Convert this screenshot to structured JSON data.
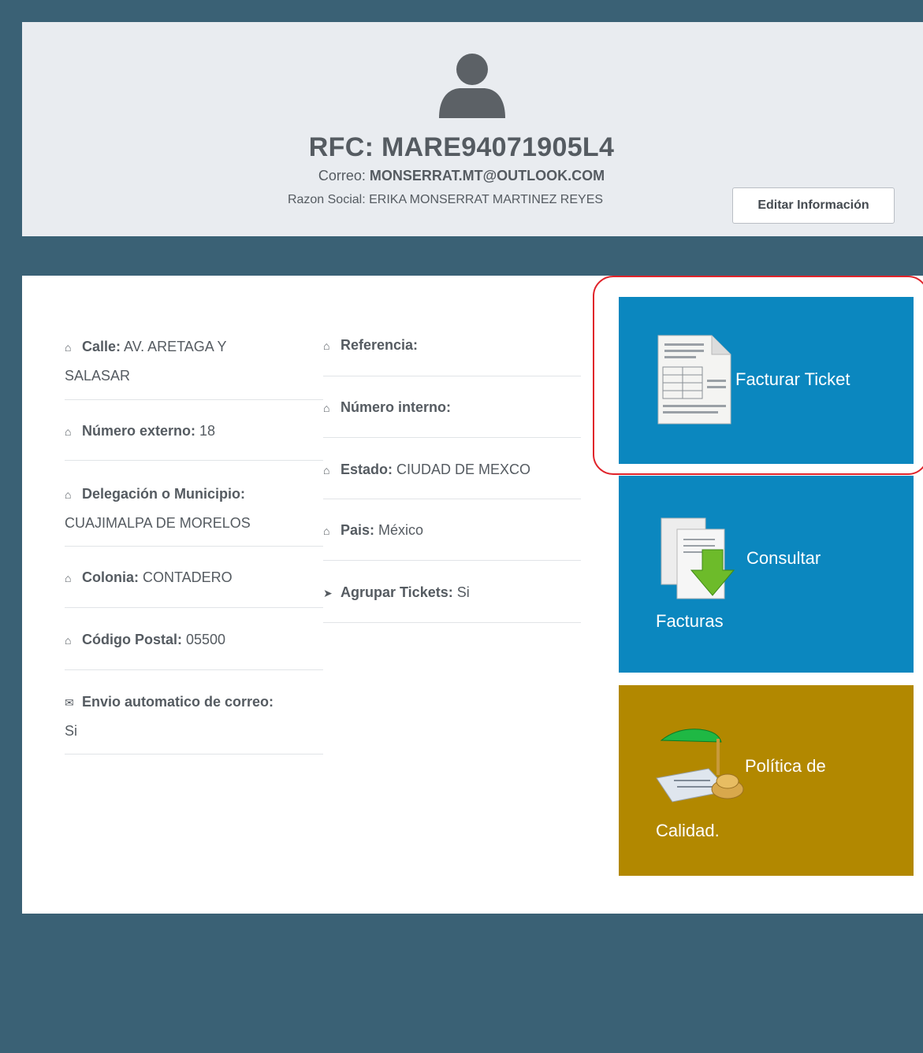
{
  "profile": {
    "rfc": "RFC: MARE94071905L4",
    "correo_label": "Correo:",
    "correo_value": "MONSERRAT.MT@OUTLOOK.COM",
    "razon_social": "Razon Social: ERIKA MONSERRAT MARTINEZ REYES",
    "edit_button": "Editar Información"
  },
  "fields_left": [
    {
      "label": "Calle:",
      "value": "AV. ARETAGA Y",
      "value2": "SALASAR",
      "icon": "home-icon"
    },
    {
      "label": "Número externo:",
      "value": "18",
      "icon": "home-icon"
    },
    {
      "label": "Delegación o Municipio:",
      "value": "",
      "value2": "CUAJIMALPA DE MORELOS",
      "icon": "home-icon"
    },
    {
      "label": "Colonia:",
      "value": "CONTADERO",
      "icon": "home-icon"
    },
    {
      "label": "Código Postal:",
      "value": "05500",
      "icon": "home-icon"
    },
    {
      "label": "Envio automatico de correo:",
      "value": "",
      "value2": "Si",
      "icon": "envelope-icon"
    }
  ],
  "fields_right": [
    {
      "label": "Referencia:",
      "value": "",
      "icon": "home-icon"
    },
    {
      "label": "Número interno:",
      "value": "",
      "icon": "home-icon"
    },
    {
      "label": "Estado:",
      "value": "CIUDAD DE MEXCO",
      "icon": "home-icon"
    },
    {
      "label": "Pais:",
      "value": "México",
      "icon": "home-icon"
    },
    {
      "label": "Agrupar Tickets:",
      "value": "Si",
      "icon": "tag-icon"
    }
  ],
  "tiles": {
    "facturar": "Facturar Ticket",
    "consultar_1": "Consultar",
    "consultar_2": "Facturas",
    "calidad_1": "Política de",
    "calidad_2": "Calidad."
  },
  "colors": {
    "background": "#3a6175",
    "tile_blue": "#0b87bf",
    "tile_gold": "#b28800",
    "highlight": "#e0232a"
  }
}
